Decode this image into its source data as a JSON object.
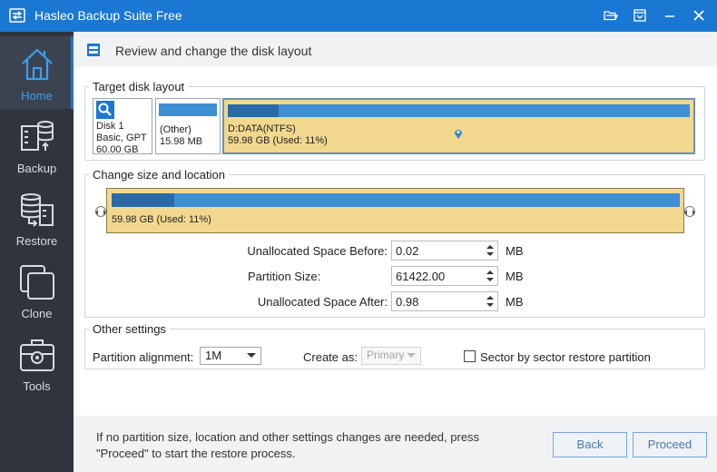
{
  "window": {
    "title": "Hasleo Backup Suite Free"
  },
  "sidebar": {
    "items": [
      {
        "label": "Home",
        "icon": "home-icon",
        "active": true
      },
      {
        "label": "Backup",
        "icon": "backup-icon"
      },
      {
        "label": "Restore",
        "icon": "restore-icon"
      },
      {
        "label": "Clone",
        "icon": "clone-icon"
      },
      {
        "label": "Tools",
        "icon": "tools-icon"
      }
    ]
  },
  "header": {
    "text": "Review and change the disk layout"
  },
  "target_layout": {
    "legend": "Target disk layout",
    "disk": {
      "name": "Disk 1",
      "type": "Basic, GPT",
      "size": "60.00 GB"
    },
    "partitions": [
      {
        "name": "(Other)",
        "size": "15.98 MB"
      },
      {
        "name": "D:DATA(NTFS)",
        "detail": "59.98 GB (Used: 11%)"
      }
    ]
  },
  "change_size": {
    "legend": "Change size and location",
    "bar_text": "59.98 GB (Used: 11%)",
    "used_percent": 11,
    "fields": [
      {
        "label": "Unallocated Space Before:",
        "value": "0.02",
        "unit": "MB"
      },
      {
        "label": "Partition Size:",
        "value": "61422.00",
        "unit": "MB"
      },
      {
        "label": "Unallocated Space After:",
        "value": "0.98",
        "unit": "MB"
      }
    ]
  },
  "other_settings": {
    "legend": "Other settings",
    "alignment_label": "Partition alignment:",
    "alignment_value": "1M",
    "create_as_label": "Create as:",
    "create_as_value": "Primary",
    "sector_label": "Sector by sector restore partition",
    "sector_checked": false
  },
  "footer": {
    "text": "If no partition size, location and other settings changes are needed, press \"Proceed\" to start the restore process.",
    "back_label": "Back",
    "proceed_label": "Proceed"
  },
  "colors": {
    "titlebar": "#1a78d2",
    "sidebar": "#30353d",
    "partition_fill": "#f2d88e",
    "partition_bar": "#3d8fd6",
    "partition_used": "#2a6aa9",
    "active_text": "#3b9ff3"
  }
}
